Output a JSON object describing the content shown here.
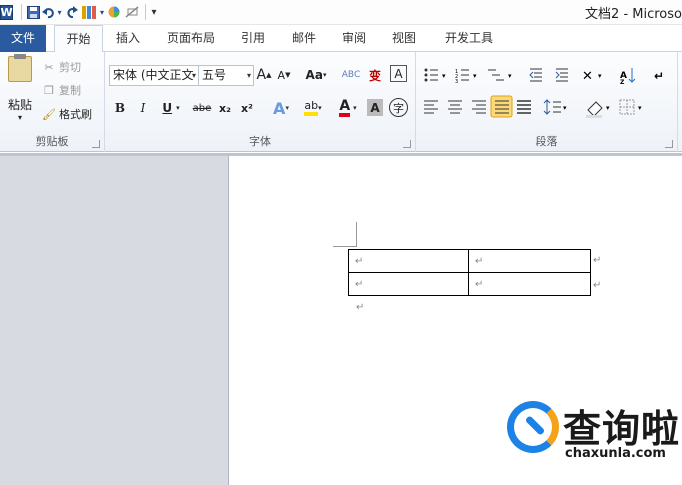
{
  "window": {
    "title": "文档2 - Microso"
  },
  "qat": {
    "logo": "W",
    "save_icon": "save-icon",
    "undo_icon": "undo-icon",
    "redo_icon": "redo-icon",
    "extra_icons": [
      "format-painter-icon",
      "color-wheel-icon",
      "eraser-icon"
    ],
    "customize": "▾"
  },
  "tabs": [
    "文件",
    "开始",
    "插入",
    "页面布局",
    "引用",
    "邮件",
    "审阅",
    "视图",
    "开发工具"
  ],
  "clipboard": {
    "group_label": "剪贴板",
    "paste": "粘贴",
    "cut": "剪切",
    "copy": "复制",
    "format_painter": "格式刷"
  },
  "font": {
    "group_label": "字体",
    "font_name": "宋体 (中文正文",
    "font_size": "五号",
    "grow": "A",
    "shrink": "A",
    "change_case": "Aa",
    "clear_format": "ABC",
    "phonetic": "变",
    "border": "A",
    "bold": "B",
    "italic": "I",
    "underline": "U",
    "strike": "abe",
    "subscript": "x₂",
    "superscript": "x²",
    "text_effect": "A",
    "highlight": "ab",
    "font_color": "A",
    "char_shading": "A",
    "enclose": "字"
  },
  "paragraph": {
    "group_label": "段落"
  },
  "document": {
    "table": [
      [
        "↵",
        "↵"
      ],
      [
        "↵",
        "↵"
      ]
    ],
    "row_end_marks": [
      "↵",
      "↵"
    ],
    "after_table_mark": "↵"
  },
  "watermark": {
    "text": "查询啦",
    "url": "chaxunla.com"
  },
  "colors": {
    "file_tab": "#2a5aa0",
    "highlight": "#ffe000",
    "font_color": "#e0001b",
    "watermark_blue": "#1c82e6",
    "watermark_orange": "#f4a21a"
  }
}
